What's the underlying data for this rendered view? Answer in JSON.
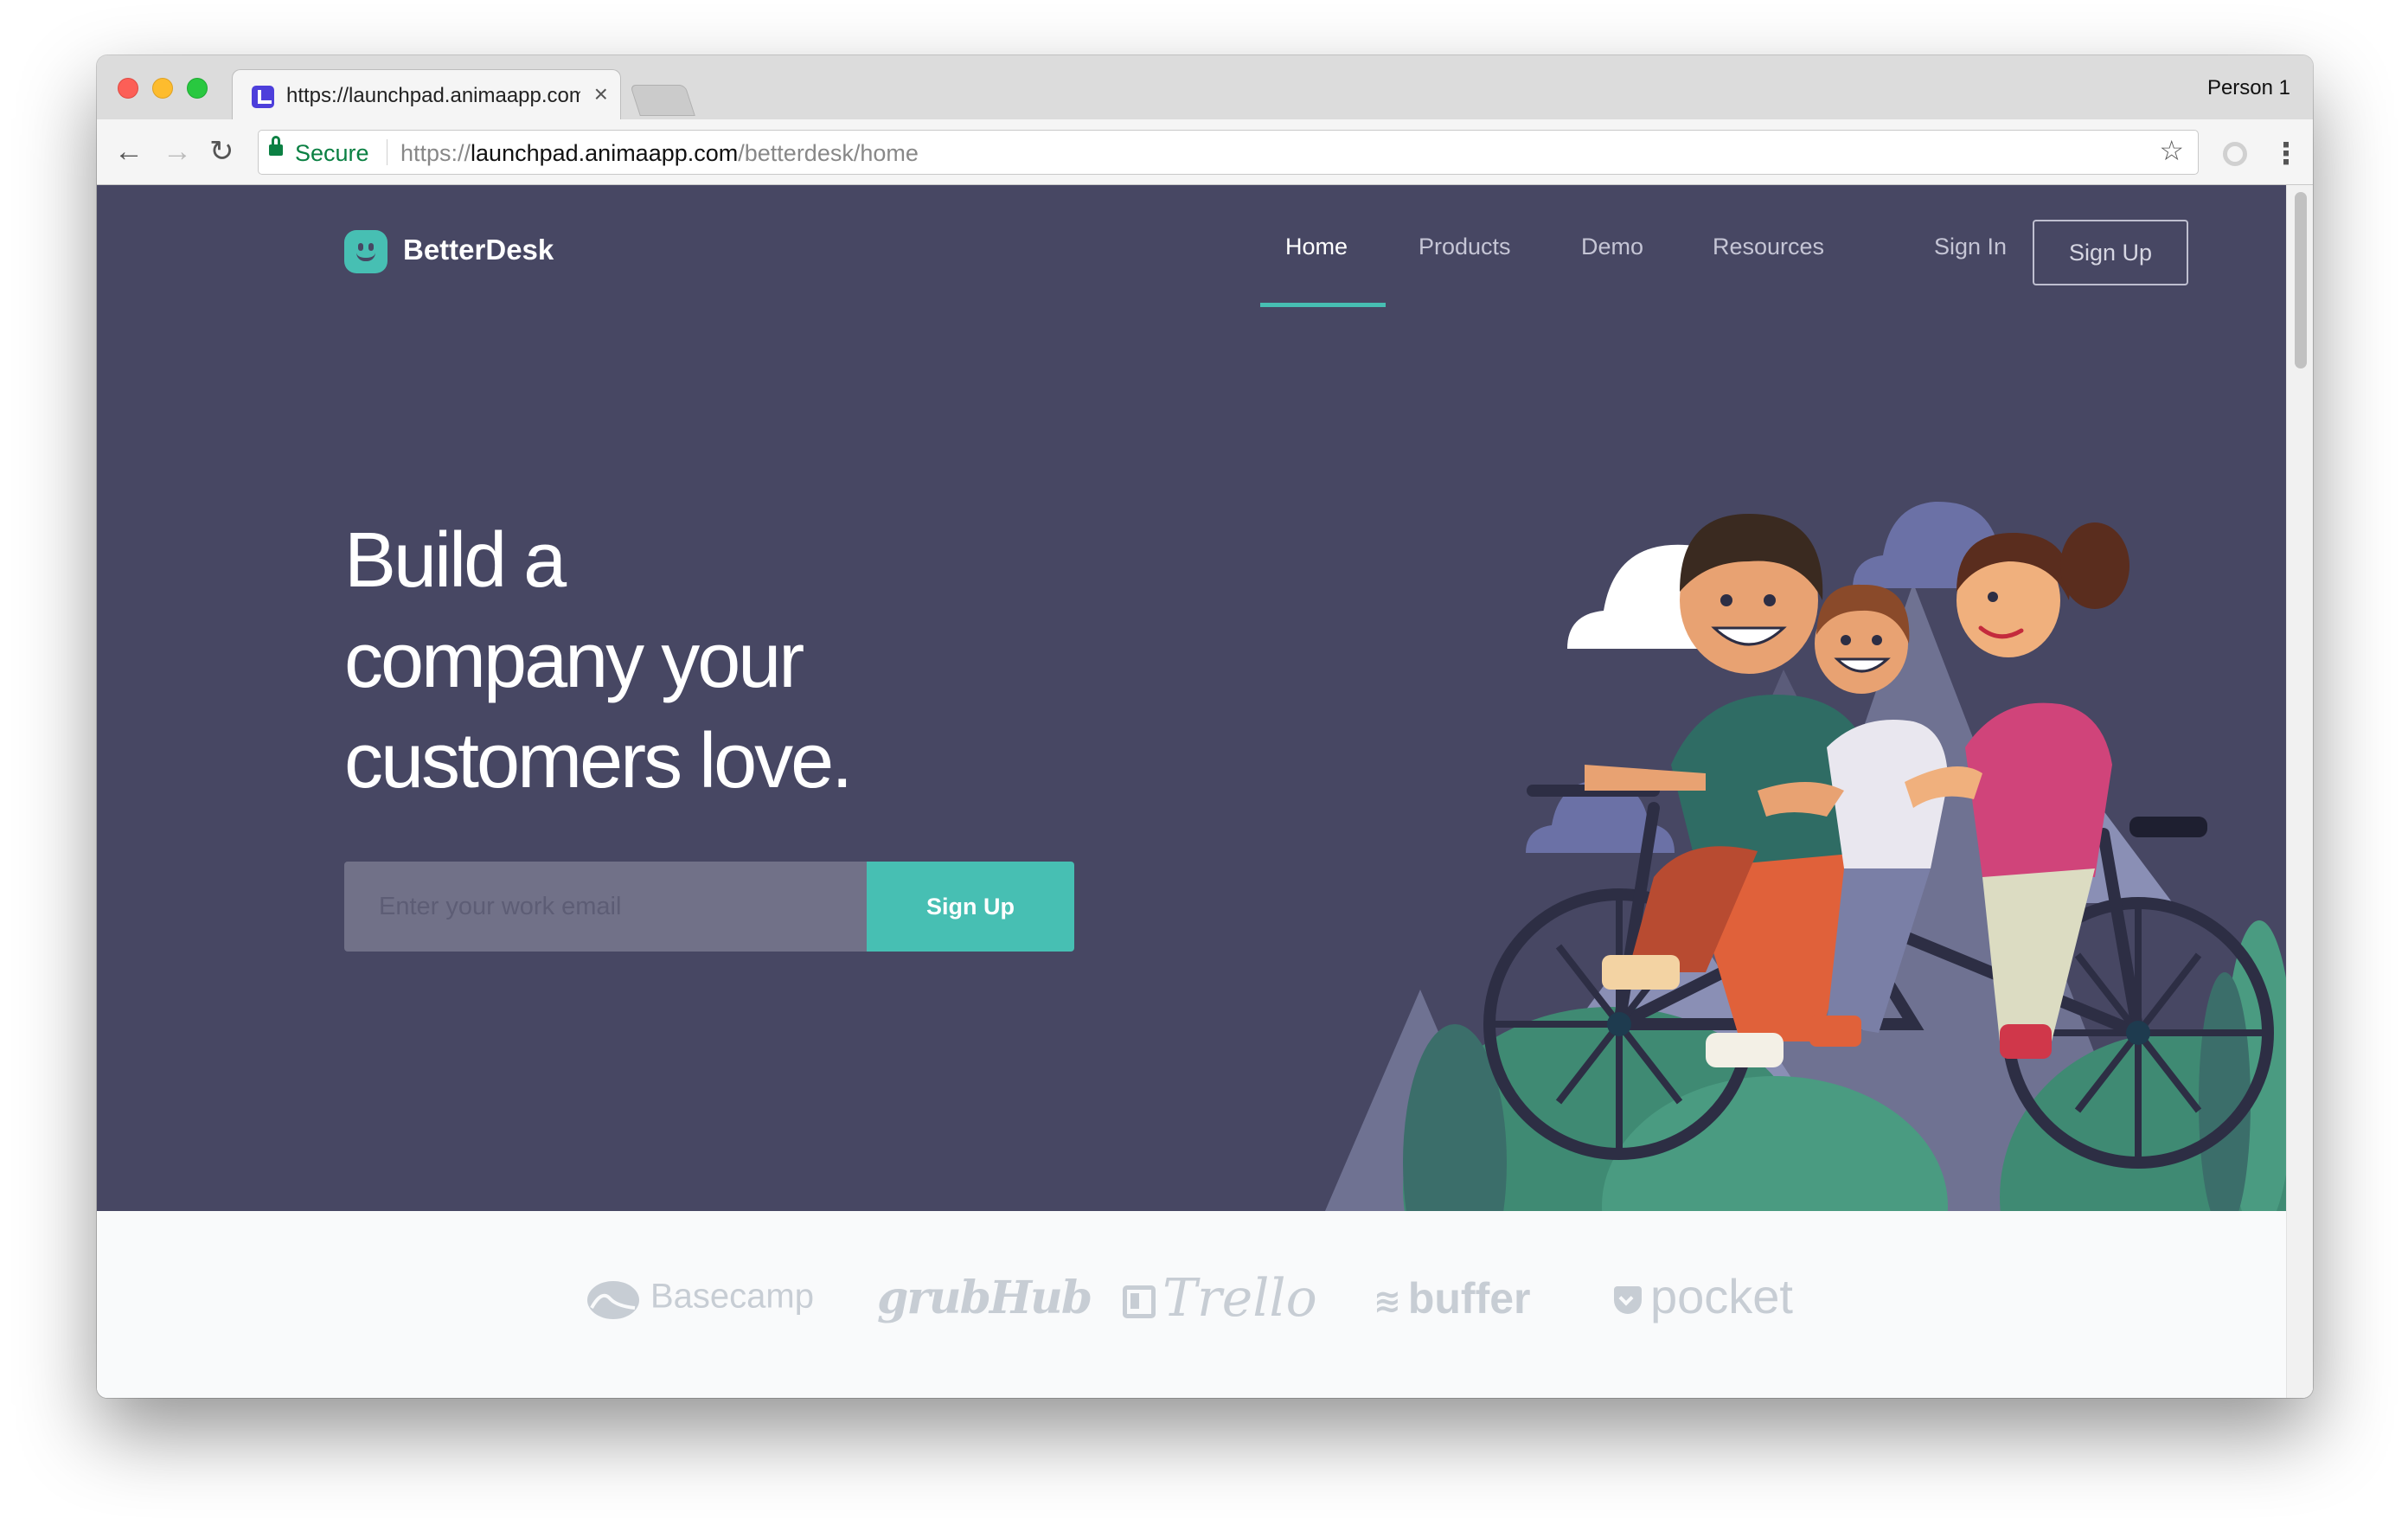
{
  "browser": {
    "tab_title": "https://launchpad.animaapp.com",
    "tab_close": "×",
    "profile": "Person 1",
    "secure_label": "Secure",
    "url_scheme": "https://",
    "url_domain": "launchpad.animaapp.com",
    "url_path": "/betterdesk/home",
    "icons": {
      "back": "←",
      "forward": "→",
      "reload": "↻",
      "star": "☆",
      "menu": "⋮"
    }
  },
  "site": {
    "brand": "BetterDesk",
    "nav": {
      "home": "Home",
      "products": "Products",
      "demo": "Demo",
      "resources": "Resources",
      "sign_in": "Sign In",
      "sign_up": "Sign Up"
    },
    "hero": {
      "headline_lines": [
        "Build a",
        "company your",
        "customers love."
      ],
      "email_placeholder": "Enter your work email",
      "cta_label": "Sign Up"
    },
    "logos": [
      "Basecamp",
      "grubHub",
      "Trello",
      "buffer",
      "pocket"
    ]
  },
  "colors": {
    "hero_bg": "#474763",
    "accent": "#47bfb3",
    "logos": "#c7cdd4"
  }
}
